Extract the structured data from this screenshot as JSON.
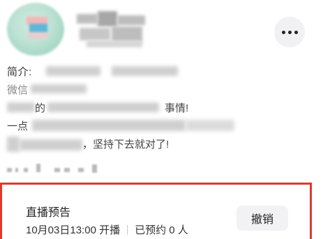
{
  "profile": {
    "bio_label": "简介: ",
    "fragments": {
      "line1_a": "微信",
      "line2_a": "的",
      "line2_b": "事情!",
      "line3_a": "一点",
      "line4_a": "，坚持下去就对了!"
    }
  },
  "more_button": {
    "icon": "more-horizontal-icon"
  },
  "live_notice": {
    "title": "直播预告",
    "start_time": "10月03日13:00 开播",
    "reserved": "已预约 0 人",
    "cancel_label": "撤销",
    "highlight_color": "#e2382e"
  }
}
